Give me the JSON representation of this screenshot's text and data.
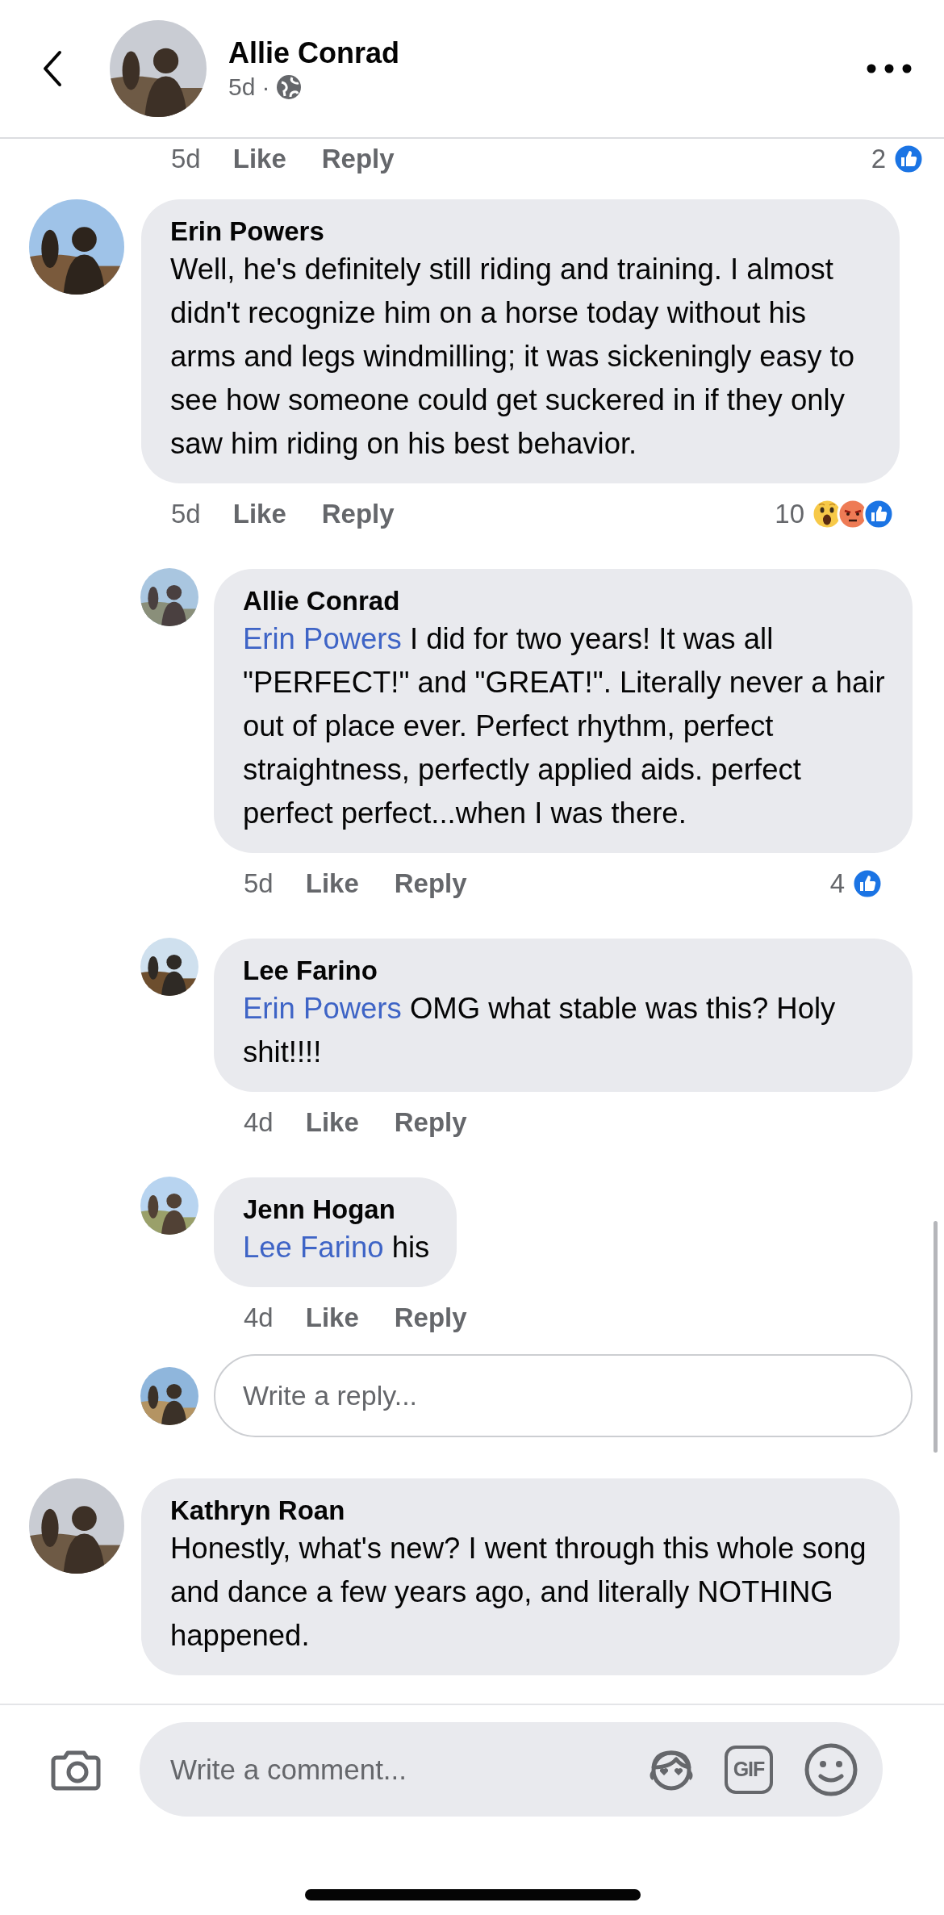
{
  "header": {
    "author": "Allie Conrad",
    "time": "5d",
    "separator": "·"
  },
  "partial_actions": {
    "time": "5d",
    "like": "Like",
    "reply": "Reply",
    "reaction_count": "2",
    "reactions": [
      {
        "kind": "like"
      }
    ]
  },
  "comments": [
    {
      "author": "Erin Powers",
      "text": "Well, he's definitely still riding and training. I almost didn't recognize him on a horse today without his arms and legs windmilling; it was sickeningly easy to see how someone could get suckered in if they only saw him riding on his best behavior.",
      "time": "5d",
      "like": "Like",
      "reply": "Reply",
      "reaction_count": "10",
      "reactions": [
        {
          "kind": "wow"
        },
        {
          "kind": "angry"
        },
        {
          "kind": "like"
        }
      ],
      "replies": [
        {
          "author": "Allie Conrad",
          "mention": "Erin Powers",
          "text": "I did for two years! It was all \"PERFECT!\" and \"GREAT!\". Literally never a hair out of place ever. Perfect rhythm, perfect straightness, perfectly applied aids. perfect perfect perfect...when I was there.",
          "time": "5d",
          "like": "Like",
          "reply": "Reply",
          "reaction_count": "4",
          "reactions": [
            {
              "kind": "like"
            }
          ]
        },
        {
          "author": "Lee Farino",
          "mention": "Erin Powers",
          "text": "OMG what stable was this? Holy shit!!!!",
          "time": "4d",
          "like": "Like",
          "reply": "Reply"
        },
        {
          "author": "Jenn Hogan",
          "mention": "Lee Farino",
          "text": "his",
          "time": "4d",
          "like": "Like",
          "reply": "Reply"
        }
      ],
      "reply_box": {
        "placeholder": "Write a reply..."
      }
    },
    {
      "author": "Kathryn Roan",
      "text": "Honestly, what's new? I went through this whole song and dance a few years ago, and literally NOTHING happened."
    }
  ],
  "composer": {
    "placeholder": "Write a comment...",
    "gif": "GIF"
  }
}
